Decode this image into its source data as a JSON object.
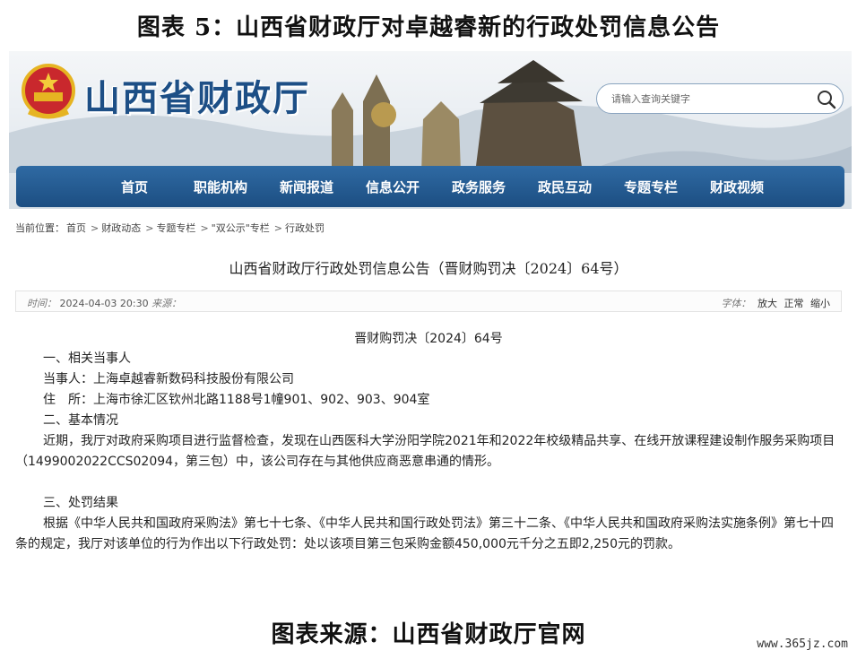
{
  "figure_title": "图表 5：山西省财政厅对卓越睿新的行政处罚信息公告",
  "site": {
    "name": "山西省财政厅",
    "search_placeholder": "请输入查询关键字"
  },
  "nav": {
    "items": [
      "首页",
      "职能机构",
      "新闻报道",
      "信息公开",
      "政务服务",
      "政民互动",
      "专题专栏",
      "财政视频"
    ]
  },
  "breadcrumb": {
    "label": "当前位置：",
    "items": [
      "首页",
      "财政动态",
      "专题专栏",
      "\"双公示\"专栏",
      "行政处罚"
    ]
  },
  "article": {
    "title": "山西省财政厅行政处罚信息公告（晋财购罚决〔2024〕64号）",
    "time_label": "时间：",
    "time": "2024-04-03 20:30",
    "source_label": "来源：",
    "font_label": "字体：",
    "font_sizes": [
      "放大",
      "正常",
      "缩小"
    ],
    "doc_no": "晋财购罚决〔2024〕64号",
    "section1": "一、相关当事人",
    "party": "当事人：上海卓越睿新数码科技股份有限公司",
    "address": "住　所：上海市徐汇区钦州北路1188号1幢901、902、903、904室",
    "section2": "二、基本情况",
    "basic": "近期，我厅对政府采购项目进行监督检查，发现在山西医科大学汾阳学院2021年和2022年校级精品共享、在线开放课程建设制作服务采购项目（1499002022CCS02094，第三包）中，该公司存在与其他供应商恶意串通的情形。",
    "section3": "三、处罚结果",
    "result": "根据《中华人民共和国政府采购法》第七十七条、《中华人民共和国行政处罚法》第三十二条、《中华人民共和国政府采购法实施条例》第七十四条的规定，我厅对该单位的行为作出以下行政处罚：处以该项目第三包采购金额450,000元千分之五即2,250元的罚款。"
  },
  "figure_source": "图表来源：山西省财政厅官网",
  "watermark": "www.365jz.com",
  "colors": {
    "brand_blue": "#1d4f86",
    "nav_blue": "#245a91"
  },
  "icons": {
    "search": "search-icon",
    "emblem": "national-emblem-icon"
  }
}
